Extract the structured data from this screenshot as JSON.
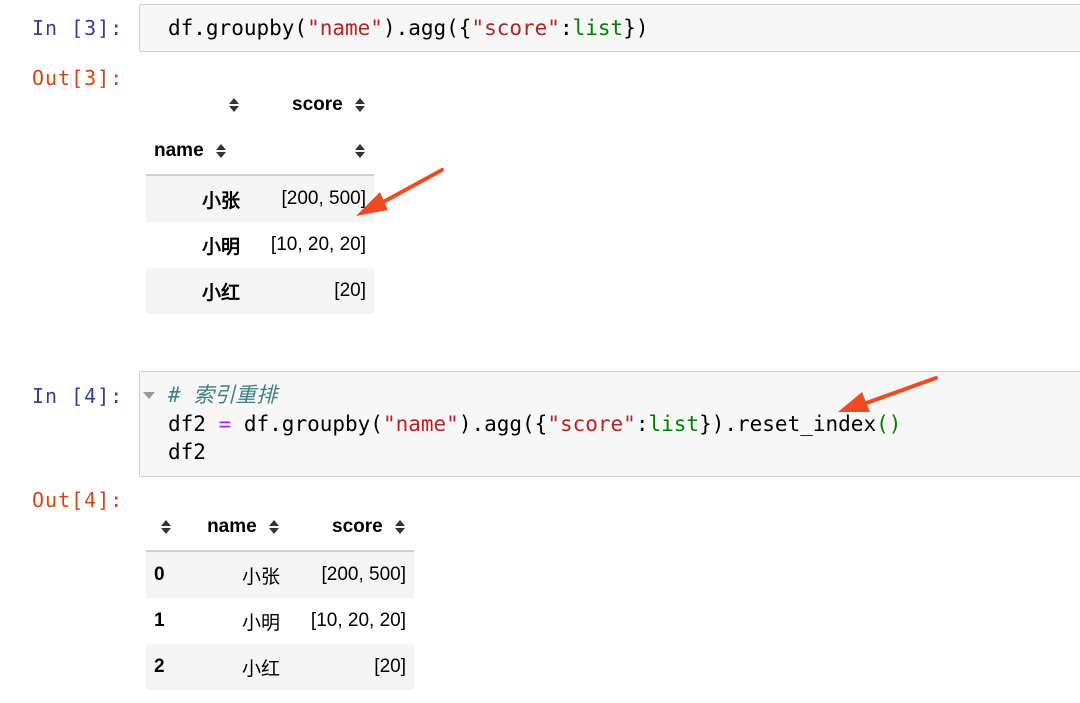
{
  "cells": [
    {
      "in_prompt": "In [3]:",
      "code": [
        "df.groupby(\"name\").agg({\"score\":list})"
      ],
      "out_prompt": "Out[3]:",
      "table": {
        "col_header": "score",
        "index_name": "name",
        "rows": [
          {
            "index": "小张",
            "score": "[200, 500]"
          },
          {
            "index": "小明",
            "score": "[10, 20, 20]"
          },
          {
            "index": "小红",
            "score": "[20]"
          }
        ]
      }
    },
    {
      "in_prompt": "In [4]:",
      "comment": "# 索引重排",
      "code": [
        "df2 = df.groupby(\"name\").agg({\"score\":list}).reset_index()",
        "df2"
      ],
      "out_prompt": "Out[4]:",
      "table": {
        "columns": [
          "name",
          "score"
        ],
        "rows": [
          {
            "index": "0",
            "name": "小张",
            "score": "[200, 500]"
          },
          {
            "index": "1",
            "name": "小明",
            "score": "[10, 20, 20]"
          },
          {
            "index": "2",
            "name": "小红",
            "score": "[20]"
          }
        ]
      }
    }
  ],
  "colors": {
    "in_prompt": "#303f9f",
    "out_prompt": "#d84315",
    "annotation_arrow": "#f04a25",
    "string": "#ba2121",
    "builtin": "#008000",
    "comment": "#408080"
  },
  "icons": [
    "sort-icon",
    "collapse-icon",
    "arrow-annotation"
  ]
}
